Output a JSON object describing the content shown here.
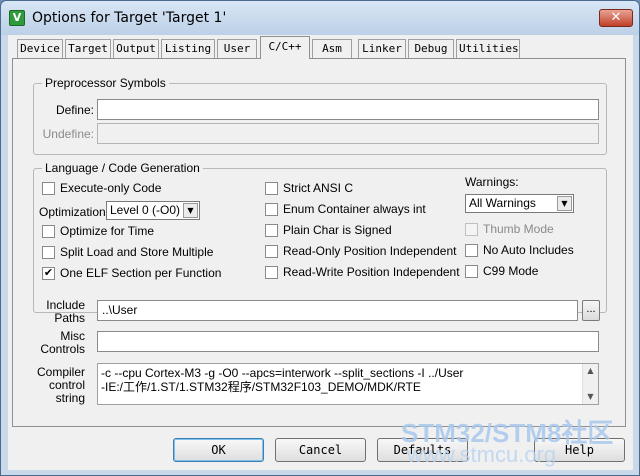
{
  "window": {
    "title": "Options for Target 'Target 1'",
    "icon_label": "V",
    "close_label": "✕"
  },
  "tabs": [
    {
      "label": "Device",
      "active": false
    },
    {
      "label": "Target",
      "active": false
    },
    {
      "label": "Output",
      "active": false
    },
    {
      "label": "Listing",
      "active": false
    },
    {
      "label": "User",
      "active": false
    },
    {
      "label": "C/C++",
      "active": true
    },
    {
      "label": "Asm",
      "active": false
    },
    {
      "label": "Linker",
      "active": false
    },
    {
      "label": "Debug",
      "active": false
    },
    {
      "label": "Utilities",
      "active": false
    }
  ],
  "preprocessor": {
    "title": "Preprocessor Symbols",
    "define_label": "Define:",
    "define_value": "",
    "undefine_label": "Undefine:",
    "undefine_value": ""
  },
  "language": {
    "title": "Language / Code Generation",
    "execute_only": {
      "label": "Execute-only Code",
      "checked": false
    },
    "optimization_label": "Optimization:",
    "optimization_value": "Level 0 (-O0)",
    "optimize_time": {
      "label": "Optimize for Time",
      "checked": false
    },
    "split_load": {
      "label": "Split Load and Store Multiple",
      "checked": false
    },
    "one_elf": {
      "label": "One ELF Section per Function",
      "checked": true
    },
    "strict_ansi": {
      "label": "Strict ANSI C",
      "checked": false
    },
    "enum_container": {
      "label": "Enum Container always int",
      "checked": false
    },
    "plain_char": {
      "label": "Plain Char is Signed",
      "checked": false
    },
    "ro_pi": {
      "label": "Read-Only Position Independent",
      "checked": false
    },
    "rw_pi": {
      "label": "Read-Write Position Independent",
      "checked": false
    },
    "warnings_label": "Warnings:",
    "warnings_value": "All Warnings",
    "thumb_mode": {
      "label": "Thumb Mode",
      "checked": false,
      "disabled": true
    },
    "no_auto_includes": {
      "label": "No Auto Includes",
      "checked": false
    },
    "c99_mode": {
      "label": "C99 Mode",
      "checked": false
    }
  },
  "paths": {
    "include_label_1": "Include",
    "include_label_2": "Paths",
    "include_value": "..\\User",
    "browse_label": "...",
    "misc_label_1": "Misc",
    "misc_label_2": "Controls",
    "misc_value": "",
    "compiler_label_1": "Compiler",
    "compiler_label_2": "control",
    "compiler_label_3": "string",
    "compiler_line_1": "-c --cpu Cortex-M3 -g -O0 --apcs=interwork --split_sections -I ../User",
    "compiler_line_2": "-IE:/工作/1.ST/1.STM32程序/STM32F103_DEMO/MDK/RTE"
  },
  "buttons": {
    "ok": "OK",
    "cancel": "Cancel",
    "defaults": "Defaults",
    "help": "Help"
  },
  "watermark": {
    "text": "STM32/STM8社区",
    "url": "www.stmcu.org"
  }
}
